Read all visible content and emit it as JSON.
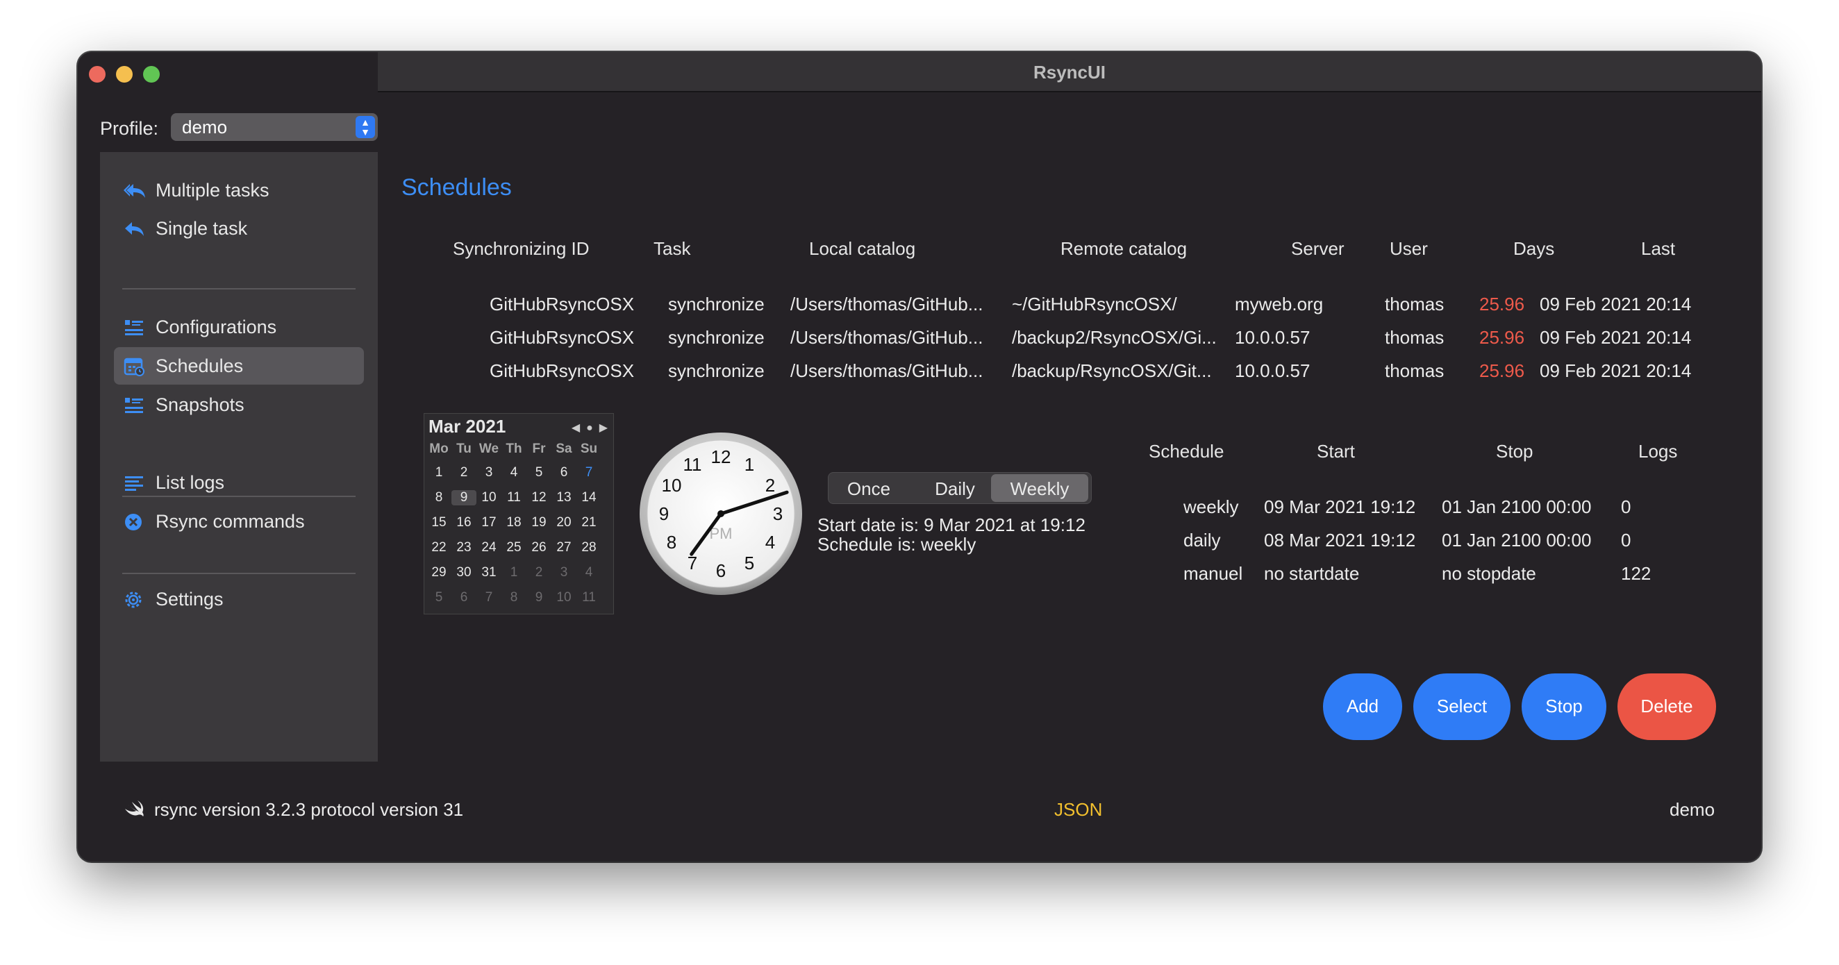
{
  "window": {
    "title": "RsyncUI"
  },
  "profile": {
    "label": "Profile:",
    "value": "demo"
  },
  "sidebar": {
    "items": [
      {
        "label": "Multiple tasks",
        "icon": "multiple-tasks-icon"
      },
      {
        "label": "Single task",
        "icon": "single-task-icon"
      },
      {
        "label": "Configurations",
        "icon": "configurations-icon"
      },
      {
        "label": "Schedules",
        "icon": "schedules-icon",
        "selected": true
      },
      {
        "label": "Snapshots",
        "icon": "snapshots-icon"
      },
      {
        "label": "List logs",
        "icon": "list-logs-icon"
      },
      {
        "label": "Rsync commands",
        "icon": "rsync-commands-icon"
      },
      {
        "label": "Settings",
        "icon": "gear-icon"
      }
    ]
  },
  "main": {
    "title": "Schedules",
    "tasks_table": {
      "headers": [
        "Synchronizing ID",
        "Task",
        "Local catalog",
        "Remote catalog",
        "Server",
        "User",
        "Days",
        "Last"
      ],
      "rows": [
        [
          "GitHubRsyncOSX",
          "synchronize",
          "/Users/thomas/GitHub...",
          "~/GitHubRsyncOSX/",
          "myweb.org",
          "thomas",
          "25.96",
          "09 Feb 2021 20:14"
        ],
        [
          "GitHubRsyncOSX",
          "synchronize",
          "/Users/thomas/GitHub...",
          "/backup2/RsyncOSX/Gi...",
          "10.0.0.57",
          "thomas",
          "25.96",
          "09 Feb 2021 20:14"
        ],
        [
          "GitHubRsyncOSX",
          "synchronize",
          "/Users/thomas/GitHub...",
          "/backup/RsyncOSX/Git...",
          "10.0.0.57",
          "thomas",
          "25.96",
          "09 Feb 2021 20:14"
        ]
      ]
    },
    "calendar": {
      "month": "Mar 2021",
      "weekdays": [
        "Mo",
        "Tu",
        "We",
        "Th",
        "Fr",
        "Sa",
        "Su"
      ],
      "weeks": [
        [
          "",
          "1",
          "2",
          "3",
          "4",
          "5",
          "6",
          "7"
        ],
        [
          "8",
          "9",
          "10",
          "11",
          "12",
          "13",
          "14"
        ],
        [
          "15",
          "16",
          "17",
          "18",
          "19",
          "20",
          "21"
        ],
        [
          "22",
          "23",
          "24",
          "25",
          "26",
          "27",
          "28"
        ],
        [
          "29",
          "30",
          "31",
          "1",
          "2",
          "3",
          "4"
        ],
        [
          "5",
          "6",
          "7",
          "8",
          "9",
          "10",
          "11"
        ]
      ],
      "selected_day": "9"
    },
    "clock": {
      "numbers": [
        "12",
        "1",
        "2",
        "3",
        "4",
        "5",
        "6",
        "7",
        "8",
        "9",
        "10",
        "11"
      ],
      "ampm": "PM",
      "hour": 7,
      "minute": 12
    },
    "schedule_type": {
      "options": [
        "Once",
        "Daily",
        "Weekly"
      ],
      "selected": "Weekly"
    },
    "start_date_text": "Start date is: 9 Mar 2021 at 19:12",
    "schedule_text": "Schedule is: weekly",
    "schedules_table": {
      "headers": [
        "Schedule",
        "Start",
        "Stop",
        "Logs"
      ],
      "rows": [
        [
          "weekly",
          "09 Mar 2021 19:12",
          "01 Jan 2100 00:00",
          "0"
        ],
        [
          "daily",
          "08 Mar 2021 19:12",
          "01 Jan 2100 00:00",
          "0"
        ],
        [
          "manuel",
          "no startdate",
          "no stopdate",
          "122"
        ]
      ]
    },
    "buttons": {
      "add": "Add",
      "select": "Select",
      "stop": "Stop",
      "delete": "Delete"
    }
  },
  "footer": {
    "rsync_version": "rsync  version 3.2.3  protocol version 31",
    "format": "JSON",
    "profile": "demo"
  },
  "colors": {
    "accent": "#2f7cf6",
    "danger": "#eb5545",
    "days_highlight": "#ee5a4b",
    "json_badge": "#f2c02e"
  }
}
